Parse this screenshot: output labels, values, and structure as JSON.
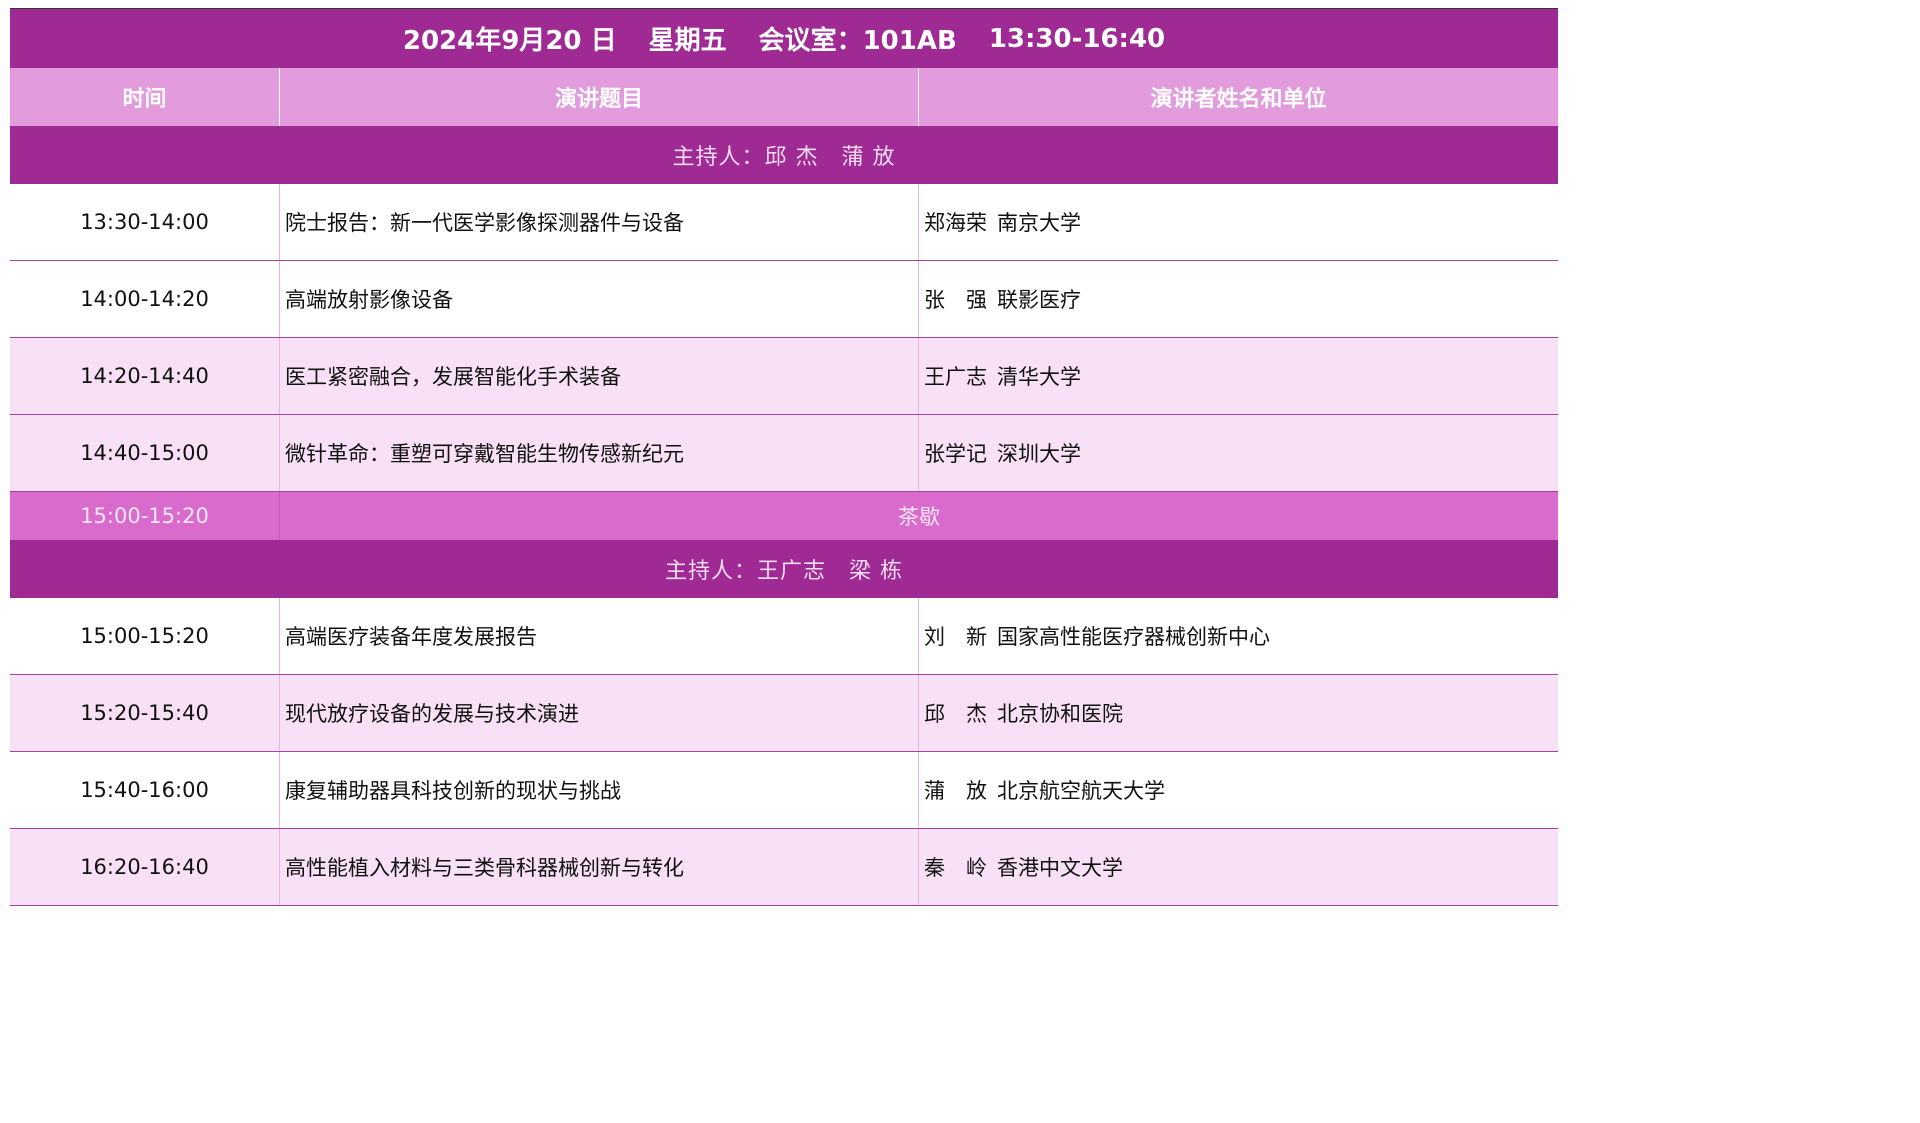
{
  "header": {
    "date": "2024年9月20 日",
    "weekday": "星期五",
    "room": "会议室：101AB",
    "time_range": "13:30-16:40"
  },
  "columns": [
    "时间",
    "演讲题目",
    "演讲者姓名和单位"
  ],
  "colors": {
    "title_bg": "#9f2a93",
    "header_bg": "#e29cdd",
    "host_bg": "#9f2a93",
    "break_bg": "#d86bcc",
    "row_pink": "#f8e1f6",
    "row_divider": "#a544a0"
  },
  "session1": {
    "host": "主持人：邱 杰　蒲 放",
    "rows": [
      {
        "time": "13:30-14:00",
        "topic": "院士报告：新一代医学影像探测器件与设备",
        "name": "郑海荣",
        "org": "南京大学"
      },
      {
        "time": "14:00-14:20",
        "topic": "高端放射影像设备",
        "name": "张　强",
        "org": "联影医疗"
      },
      {
        "time": "14:20-14:40",
        "topic": "医工紧密融合，发展智能化手术装备",
        "name": "王广志",
        "org": "清华大学"
      },
      {
        "time": "14:40-15:00",
        "topic": "微针革命：重塑可穿戴智能生物传感新纪元",
        "name": "张学记",
        "org": "深圳大学"
      }
    ]
  },
  "break": {
    "time": "15:00-15:20",
    "label": "茶歇"
  },
  "session2": {
    "host": "主持人：王广志　梁 栋",
    "rows": [
      {
        "time": "15:00-15:20",
        "topic": "高端医疗装备年度发展报告",
        "name": "刘　新",
        "org": "国家高性能医疗器械创新中心"
      },
      {
        "time": "15:20-15:40",
        "topic": "现代放疗设备的发展与技术演进",
        "name": "邱　杰",
        "org": "北京协和医院"
      },
      {
        "time": "15:40-16:00",
        "topic": "康复辅助器具科技创新的现状与挑战",
        "name": "蒲　放",
        "org": "北京航空航天大学"
      },
      {
        "time": "16:20-16:40",
        "topic": "高性能植入材料与三类骨科器械创新与转化",
        "name": "秦　岭",
        "org": "香港中文大学"
      }
    ]
  }
}
